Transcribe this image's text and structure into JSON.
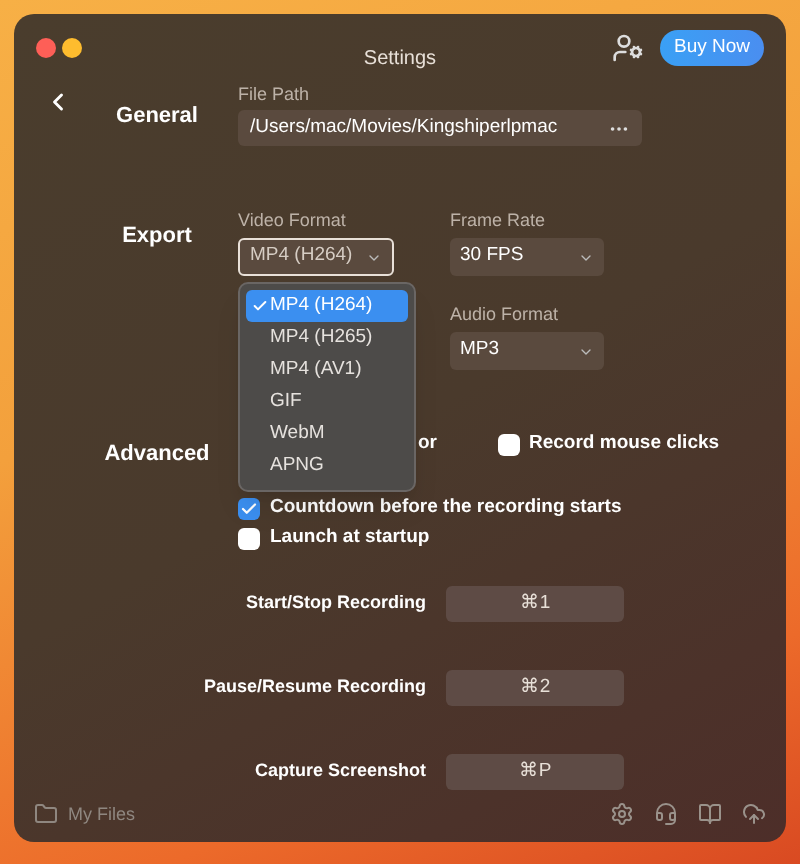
{
  "window": {
    "title": "Settings"
  },
  "header": {
    "buy_button": "Buy Now"
  },
  "general": {
    "heading": "General",
    "file_path": {
      "label": "File Path",
      "value": "/Users/mac/Movies/Kingshiperlpmac"
    }
  },
  "export": {
    "heading": "Export",
    "video_format": {
      "label": "Video Format",
      "value": "MP4 (H264)",
      "open": true,
      "options": [
        {
          "label": "MP4 (H264)",
          "selected": true
        },
        {
          "label": "MP4 (H265)",
          "selected": false
        },
        {
          "label": "MP4 (AV1)",
          "selected": false
        },
        {
          "label": "GIF",
          "selected": false
        },
        {
          "label": "WebM",
          "selected": false
        },
        {
          "label": "APNG",
          "selected": false
        }
      ]
    },
    "frame_rate": {
      "label": "Frame Rate",
      "value": "30 FPS"
    },
    "audio_format": {
      "label": "Audio Format",
      "value": "MP3"
    }
  },
  "advanced": {
    "heading": "Advanced",
    "first_row": [
      {
        "kind": "fragment",
        "label": "or"
      },
      {
        "kind": "checkbox",
        "label": "Record mouse clicks",
        "checked": false
      }
    ],
    "options": [
      {
        "label": "Countdown before the recording starts",
        "checked": true
      },
      {
        "label": "Launch at startup",
        "checked": false
      }
    ]
  },
  "shortcuts": [
    {
      "label": "Start/Stop Recording",
      "keys": "⌘1"
    },
    {
      "label": "Pause/Resume Recording",
      "keys": "⌘2"
    },
    {
      "label": "Capture Screenshot",
      "keys": "⌘P"
    }
  ],
  "footer": {
    "my_files": "My Files"
  }
}
